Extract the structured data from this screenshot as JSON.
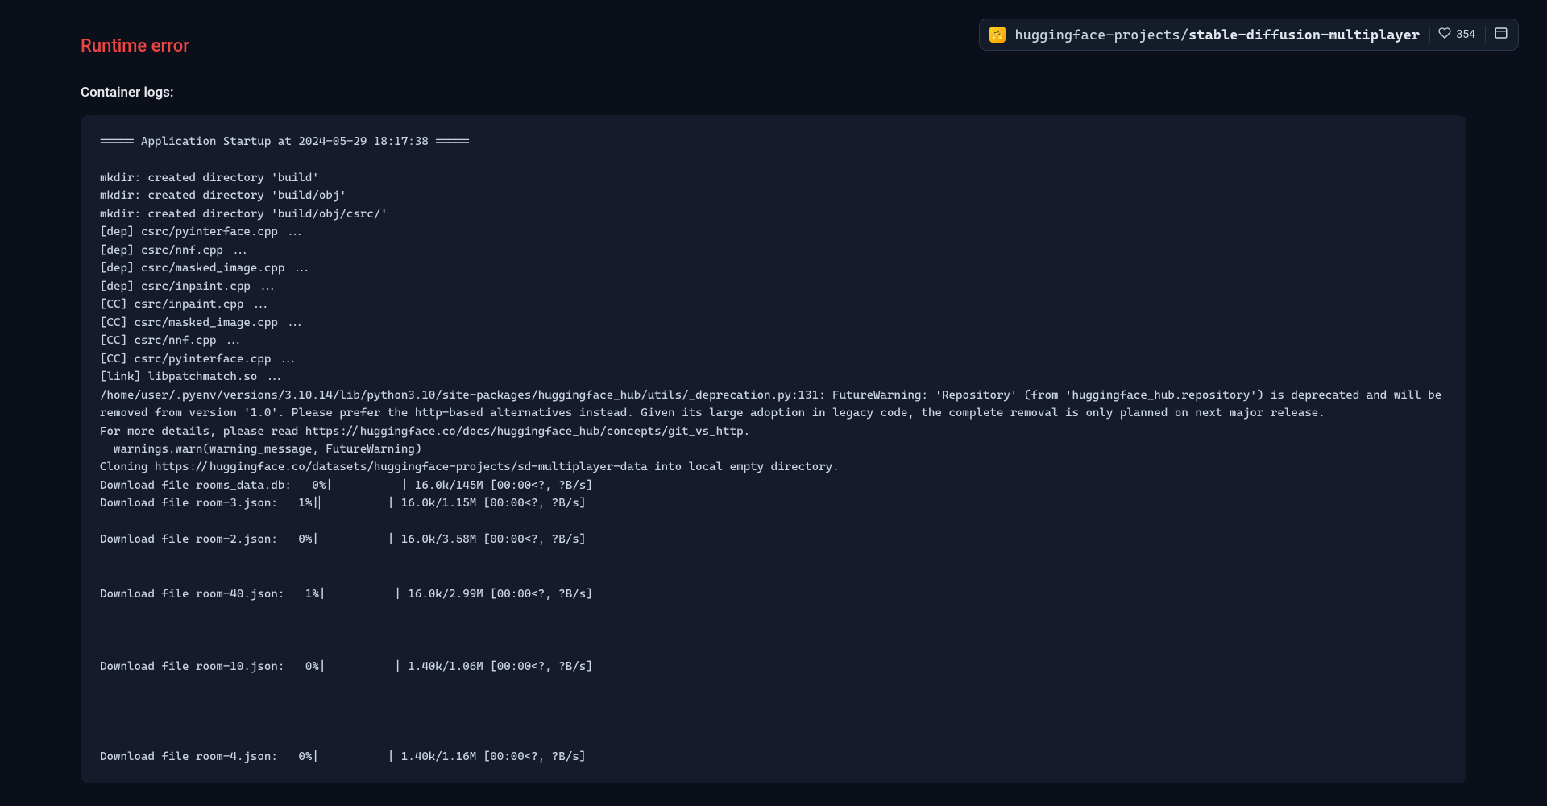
{
  "header": {
    "org": "huggingface-projects",
    "separator": "/",
    "repo": "stable-diffusion-multiplayer",
    "likes": "354"
  },
  "page": {
    "error_title": "Runtime error",
    "logs_label": "Container logs:"
  },
  "logs": "===== Application Startup at 2024-05-29 18:17:38 =====\n\nmkdir: created directory 'build'\nmkdir: created directory 'build/obj'\nmkdir: created directory 'build/obj/csrc/'\n[dep] csrc/pyinterface.cpp ...\n[dep] csrc/nnf.cpp ...\n[dep] csrc/masked_image.cpp ...\n[dep] csrc/inpaint.cpp ...\n[CC] csrc/inpaint.cpp ...\n[CC] csrc/masked_image.cpp ...\n[CC] csrc/nnf.cpp ...\n[CC] csrc/pyinterface.cpp ...\n[link] libpatchmatch.so ...\n/home/user/.pyenv/versions/3.10.14/lib/python3.10/site-packages/huggingface_hub/utils/_deprecation.py:131: FutureWarning: 'Repository' (from 'huggingface_hub.repository') is deprecated and will be removed from version '1.0'. Please prefer the http-based alternatives instead. Given its large adoption in legacy code, the complete removal is only planned on next major release.\nFor more details, please read https://huggingface.co/docs/huggingface_hub/concepts/git_vs_http.\n  warnings.warn(warning_message, FutureWarning)\nCloning https://huggingface.co/datasets/huggingface-projects/sd-multiplayer-data into local empty directory.\nDownload file rooms_data.db:   0%|          | 16.0k/145M [00:00<?, ?B/s]\nDownload file room-3.json:   1%|▏         | 16.0k/1.15M [00:00<?, ?B/s]\n\nDownload file room-2.json:   0%|          | 16.0k/3.58M [00:00<?, ?B/s]\n\n\nDownload file room-40.json:   1%|          | 16.0k/2.99M [00:00<?, ?B/s]\n\n\n\nDownload file room-10.json:   0%|          | 1.40k/1.06M [00:00<?, ?B/s]\n\n\n\n\nDownload file room-4.json:   0%|          | 1.40k/1.16M [00:00<?, ?B/s]"
}
